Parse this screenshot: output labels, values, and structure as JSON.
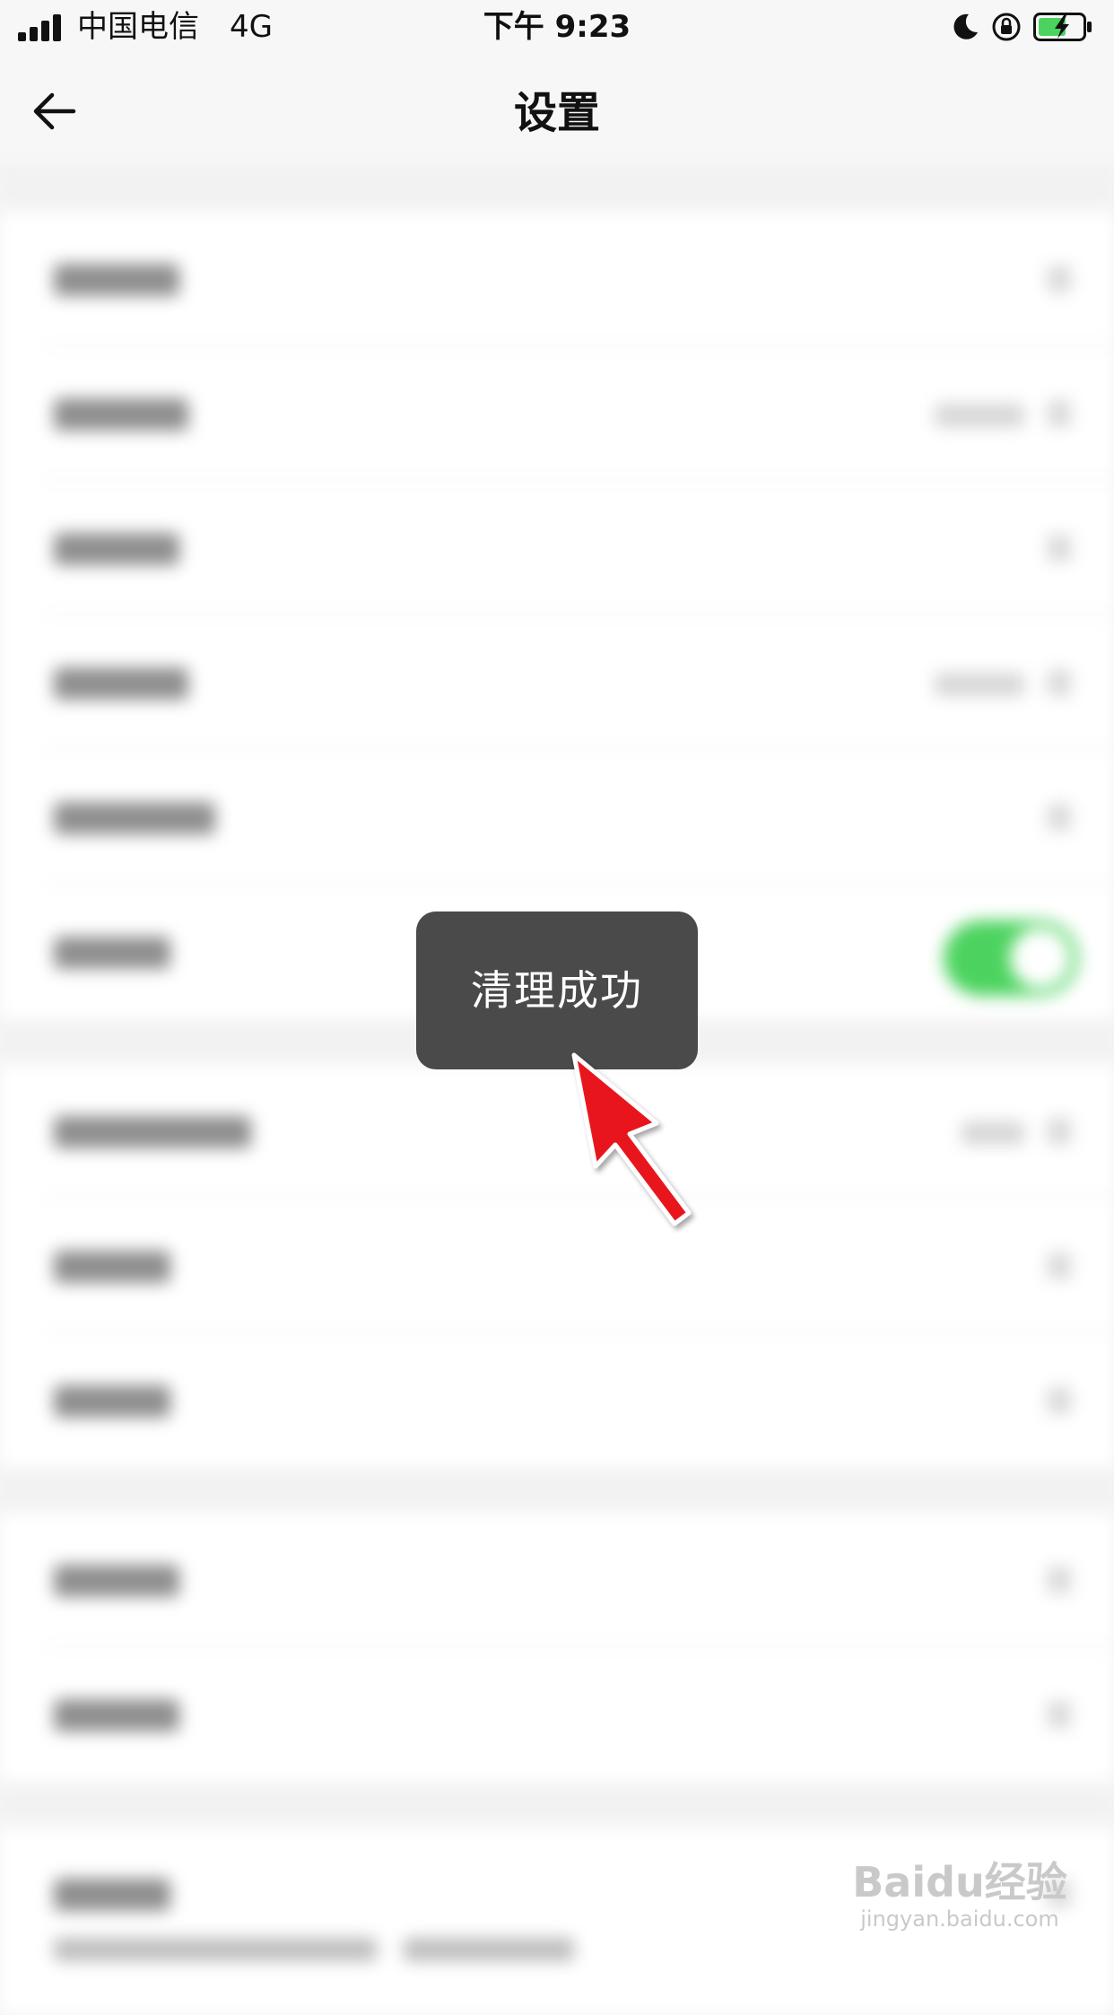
{
  "status_bar": {
    "carrier": "中国电信",
    "network": "4G",
    "time": "下午 9:23",
    "icons": [
      "signal-icon",
      "moon-icon",
      "orientation-lock-icon",
      "battery-charging-icon"
    ]
  },
  "nav": {
    "back_icon": "back-arrow-icon",
    "title": "设置"
  },
  "toast": {
    "message": "清理成功"
  },
  "annotation": {
    "arrow_color": "#e8141a"
  },
  "watermark": {
    "brand": "Baidu经验",
    "url": "jingyan.baidu.com"
  },
  "colors": {
    "toggle_on": "#4cd35f",
    "toast_bg": "#4a4a4a"
  }
}
